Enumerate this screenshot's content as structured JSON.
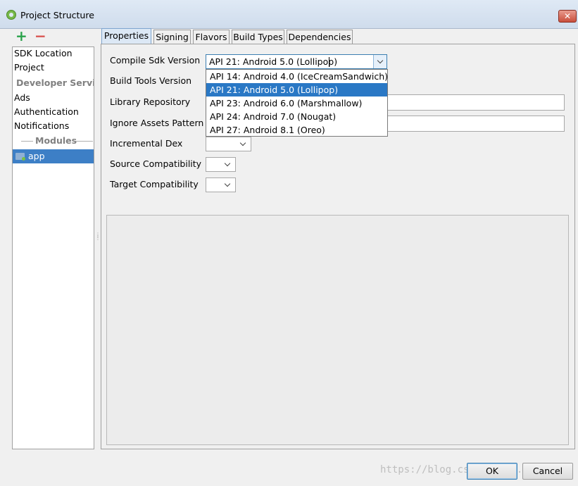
{
  "window": {
    "title": "Project Structure",
    "close_label": "✕"
  },
  "left_panel": {
    "add_label": "+",
    "remove_label": "−",
    "items": [
      {
        "label": "SDK Location"
      },
      {
        "label": "Project"
      },
      {
        "label": "Developer Servi..."
      },
      {
        "label": "Ads"
      },
      {
        "label": "Authentication"
      },
      {
        "label": "Notifications"
      },
      {
        "label": "Modules"
      },
      {
        "label": "app"
      }
    ]
  },
  "tabs": [
    {
      "label": "Properties"
    },
    {
      "label": "Signing"
    },
    {
      "label": "Flavors"
    },
    {
      "label": "Build Types"
    },
    {
      "label": "Dependencies"
    }
  ],
  "form": {
    "compile_sdk": {
      "label": "Compile Sdk Version",
      "value": "API 21: Android 5.0 (Lollipop)",
      "options": [
        "API 14: Android 4.0 (IceCreamSandwich)",
        "API 21: Android 5.0 (Lollipop)",
        "API 23: Android 6.0 (Marshmallow)",
        "API 24: Android 7.0 (Nougat)",
        "API 27: Android 8.1 (Oreo)"
      ],
      "selected_index": 1
    },
    "build_tools": {
      "label": "Build Tools Version"
    },
    "library_repository": {
      "label": "Library Repository"
    },
    "ignore_assets": {
      "label": "Ignore Assets Pattern"
    },
    "incremental_dex": {
      "label": "Incremental Dex"
    },
    "source_compat": {
      "label": "Source Compatibility"
    },
    "target_compat": {
      "label": "Target Compatibility"
    }
  },
  "buttons": {
    "ok": "OK",
    "cancel": "Cancel"
  },
  "watermark": "https://blog.csdn.net/..."
}
